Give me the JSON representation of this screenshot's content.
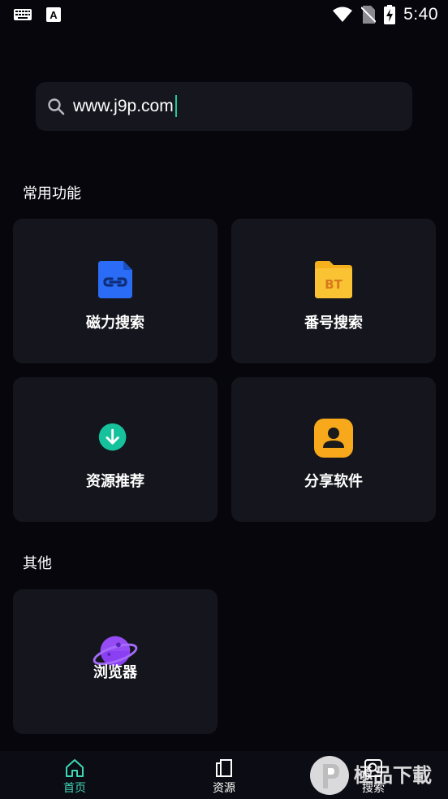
{
  "status_bar": {
    "time": "5:40"
  },
  "search": {
    "value": "www.j9p.com"
  },
  "sections": {
    "common_title": "常用功能",
    "other_title": "其他"
  },
  "cards": {
    "magnet": {
      "label": "磁力搜索",
      "icon": "link-document-icon",
      "color": "#2a6cf5"
    },
    "code": {
      "label": "番号搜索",
      "icon": "bt-folder-icon",
      "color": "#f5b11d",
      "icon_text": "BT"
    },
    "resource": {
      "label": "资源推荐",
      "icon": "download-circle-icon",
      "color": "#16c29b"
    },
    "share": {
      "label": "分享软件",
      "icon": "user-badge-icon",
      "color": "#f7a81b"
    },
    "browser": {
      "label": "浏览器",
      "icon": "planet-icon",
      "color": "#8a3ff2"
    }
  },
  "nav": {
    "home": {
      "label": "首页",
      "icon": "home-icon"
    },
    "resources": {
      "label": "资源",
      "icon": "pages-icon"
    },
    "search": {
      "label": "搜索",
      "icon": "search-square-icon"
    }
  },
  "accent_color": "#3fd6b5",
  "watermark": {
    "text": "極品下載"
  }
}
